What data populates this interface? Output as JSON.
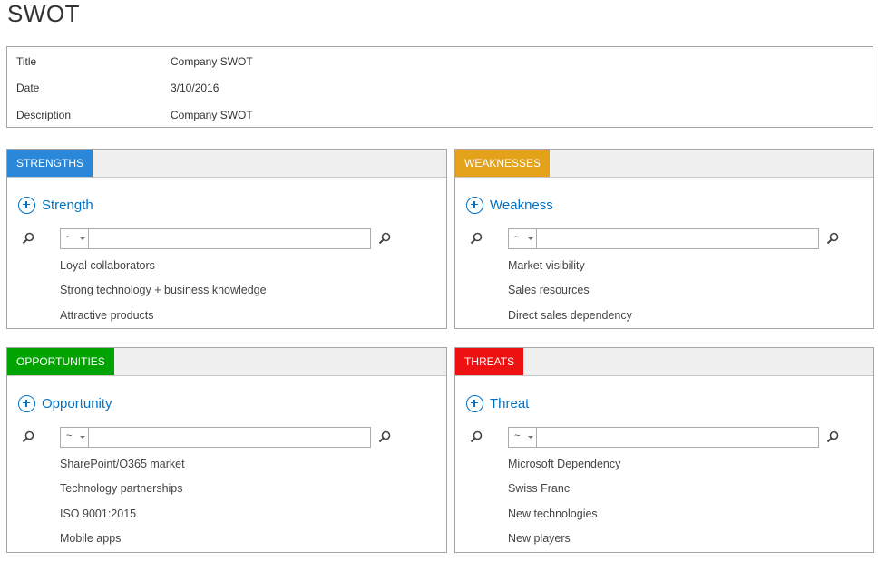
{
  "page": {
    "title": "SWOT"
  },
  "info": {
    "title_label": "Title",
    "title_value": "Company SWOT",
    "date_label": "Date",
    "date_value": "3/10/2016",
    "description_label": "Description",
    "description_value": "Company SWOT"
  },
  "colors": {
    "strengths": "#2b88d8",
    "weaknesses": "#e3a21a",
    "opportunities": "#00a300",
    "threats": "#ee1111",
    "link": "#0072c6"
  },
  "panels": {
    "strengths": {
      "tab": "STRENGTHS",
      "add_label": "Strength",
      "select_value": "~",
      "search_value": "",
      "items": [
        "Loyal collaborators",
        "Strong technology + business knowledge",
        "Attractive products"
      ]
    },
    "weaknesses": {
      "tab": "WEAKNESSES",
      "add_label": "Weakness",
      "select_value": "~",
      "search_value": "",
      "items": [
        "Market visibility",
        "Sales resources",
        "Direct sales dependency"
      ]
    },
    "opportunities": {
      "tab": "OPPORTUNITIES",
      "add_label": "Opportunity",
      "select_value": "~",
      "search_value": "",
      "items": [
        "SharePoint/O365 market",
        "Technology partnerships",
        "ISO 9001:2015",
        "Mobile apps"
      ]
    },
    "threats": {
      "tab": "THREATS",
      "add_label": "Threat",
      "select_value": "~",
      "search_value": "",
      "items": [
        "Microsoft Dependency",
        "Swiss Franc",
        "New technologies",
        "New players"
      ]
    }
  },
  "icons": {
    "add": "plus-circle-icon",
    "search": "magnifier-icon",
    "dropdown": "chevron-down-icon"
  }
}
